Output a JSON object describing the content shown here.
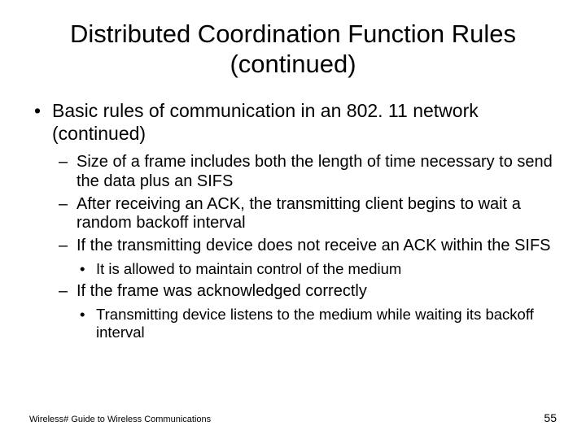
{
  "title": "Distributed Coordination Function Rules (continued)",
  "bullet1": "Basic rules of communication in an 802. 11 network (continued)",
  "sub": {
    "a": "Size of a frame includes both the length of time necessary to send the data plus an SIFS",
    "b": "After receiving an ACK, the transmitting client begins to wait a random backoff interval",
    "c": "If the transmitting device does not receive an ACK within the SIFS",
    "c1": "It is allowed to maintain control of the medium",
    "d": "If the frame was acknowledged correctly",
    "d1": "Transmitting device listens to the medium while waiting its backoff interval"
  },
  "footer_source": "Wireless# Guide to Wireless Communications",
  "footer_page": "55"
}
